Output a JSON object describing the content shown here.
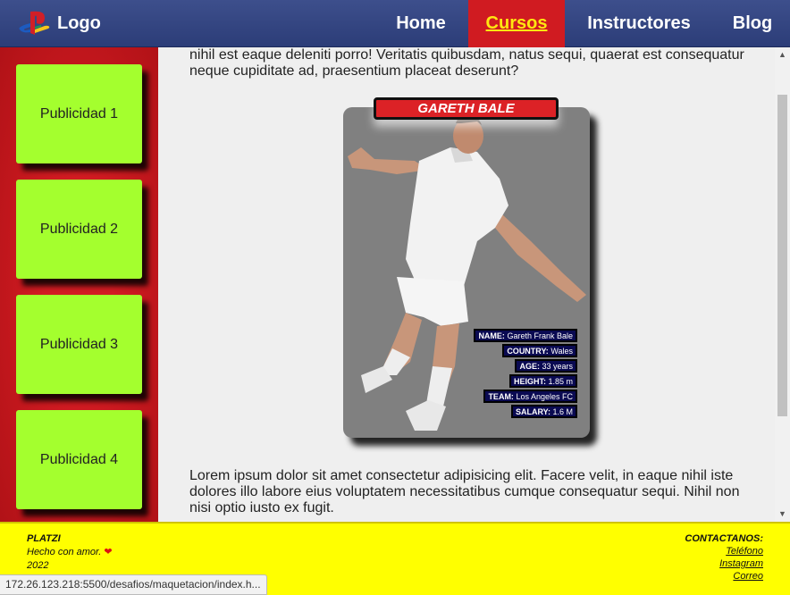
{
  "header": {
    "logo_text": "Logo",
    "logo_icon": "playstation-icon",
    "nav": [
      "Home",
      "Cursos",
      "Instructores",
      "Blog"
    ],
    "active_nav": "Cursos"
  },
  "sidebar": {
    "ads": [
      "Publicidad 1",
      "Publicidad 2",
      "Publicidad 3",
      "Publicidad 4"
    ]
  },
  "main": {
    "paragraph_top": "nihil est eaque deleniti porro! Veritatis quibusdam, natus sequi, quaerat est consequatur neque cupiditate ad, praesentium placeat deserunt?",
    "card": {
      "title": "GARETH BALE",
      "stats": [
        {
          "label": "NAME:",
          "value": "Gareth Frank Bale"
        },
        {
          "label": "COUNTRY:",
          "value": "Wales"
        },
        {
          "label": "AGE:",
          "value": "33 years"
        },
        {
          "label": "HEIGHT:",
          "value": "1.85 m"
        },
        {
          "label": "TEAM:",
          "value": "Los Angeles FC"
        },
        {
          "label": "SALARY:",
          "value": "1.6 M"
        }
      ]
    },
    "paragraph_bottom": "Lorem ipsum dolor sit amet consectetur adipisicing elit. Facere velit, in eaque nihil iste dolores illo labore eius voluptatem necessitatibus cumque consequatur sequi. Nihil non nisi optio iusto ex fugit."
  },
  "footer": {
    "brand": "PLATZI",
    "made_with": "Hecho con amor.",
    "year": "2022",
    "contact_title": "CONTACTANOS:",
    "links": [
      "Teléfono",
      "Instagram",
      "Correo"
    ]
  },
  "statusbar": {
    "url": "172.26.123.218:5500/desafios/maquetacion/index.h..."
  },
  "colors": {
    "header": "#34468a",
    "nav_active_bg": "#d01b21",
    "nav_active_text": "#ffe710",
    "sidebar": "#c8161c",
    "ad_box": "#a4ff2e",
    "footer": "#ffff00",
    "card_title": "#dc2226",
    "stat_bg": "#0a0a52"
  }
}
